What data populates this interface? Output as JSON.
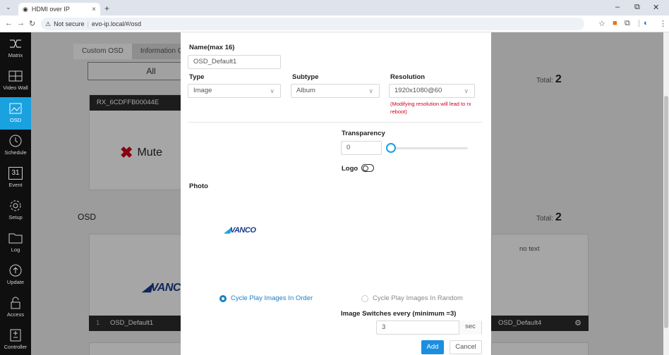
{
  "browser": {
    "tab_title": "HDMI over IP",
    "tab_close": "×",
    "new_tab": "+",
    "not_secure": "Not secure",
    "url": "evo-ip.local/#/osd",
    "win_min": "–",
    "win_restore": "⧉",
    "win_close": "✕"
  },
  "sidebar": {
    "items": [
      {
        "label": "Matrix"
      },
      {
        "label": "Video Wall"
      },
      {
        "label": "OSD"
      },
      {
        "label": "Schedule"
      },
      {
        "label": "Event",
        "day": "31"
      },
      {
        "label": "Setup"
      },
      {
        "label": "Log"
      },
      {
        "label": "Update"
      },
      {
        "label": "Access"
      },
      {
        "label": "Controller"
      }
    ]
  },
  "page": {
    "tabs": [
      "Custom OSD",
      "Information OSD"
    ],
    "filter_all": "All",
    "total_label": "Total:",
    "total_top": "2",
    "total_bottom": "2",
    "card_rx": "RX_6CDFFB00044E",
    "mute_label": "Mute",
    "section_osd": "OSD",
    "no_text": "no text",
    "osd_default1_index": "1",
    "osd_default1": "OSD_Default1",
    "osd_default4": "OSD_Default4"
  },
  "modal": {
    "name_label": "Name(max 16)",
    "name_value": "OSD_Default1",
    "type_label": "Type",
    "type_value": "Image",
    "subtype_label": "Subtype",
    "subtype_value": "Album",
    "resolution_label": "Resolution",
    "resolution_value": "1920x1080@60",
    "resolution_warning": "(Modifying resolution will lead to rx reboot)",
    "transparency_label": "Transparency",
    "transparency_value": "0",
    "logo_label": "Logo",
    "photo_label": "Photo",
    "photo_brand": "VANCO",
    "cycle_order": "Cycle Play Images In Order",
    "cycle_random": "Cycle Play Images In Random",
    "switch_label": "Image Switches every (minimum =3)",
    "switch_value": "3",
    "switch_unit": "sec",
    "add_button": "Add",
    "cancel_button": "Cancel"
  },
  "colors": {
    "accent": "#1aa1e0",
    "sidebar_bg": "#0f0f0f",
    "warning": "#d0021b",
    "primary_button": "#1a8fe0"
  }
}
